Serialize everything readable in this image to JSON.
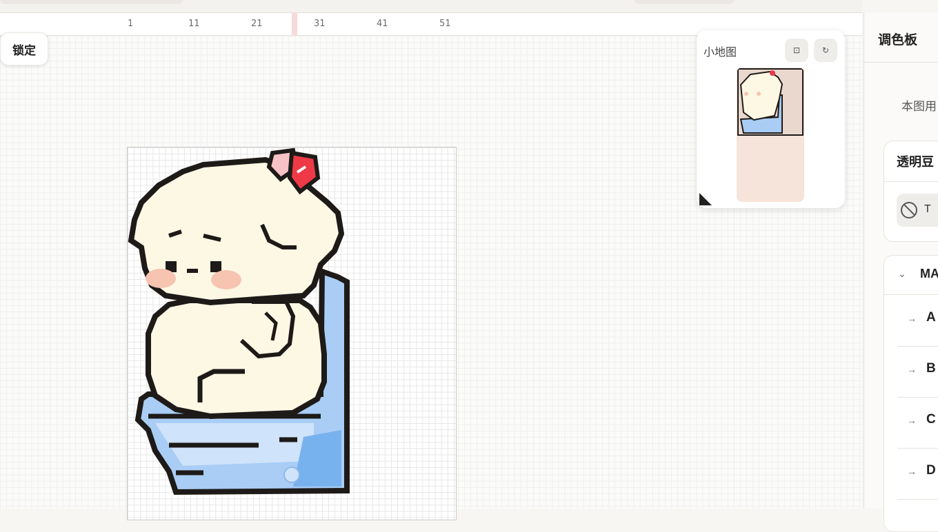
{
  "ruler": {
    "ticks": [
      "1",
      "11",
      "21",
      "31",
      "41",
      "51"
    ]
  },
  "toolbar": {
    "lock_label": "锁定"
  },
  "minimap": {
    "title": "小地图",
    "fit_icon": "fit-screen-icon",
    "refresh_icon": "refresh-icon"
  },
  "palette": {
    "title": "调色板",
    "subtitle": "本图用",
    "transparent_section_title": "透明豆",
    "transparent_chip_label": "T",
    "group_title": "MA",
    "rows": [
      "A",
      "B",
      "C",
      "D"
    ]
  },
  "colors": {
    "outline": "#1e1a18",
    "cream": "#fdf8e4",
    "blush": "#f6c4b1",
    "bow": "#ee3a47",
    "bow_light": "#f8c2c6",
    "bowl": "#a9cdf5",
    "bowl_light": "#cfe3fa",
    "bowl_dark": "#78b2ee",
    "preview_bg": "#f6e3da"
  }
}
